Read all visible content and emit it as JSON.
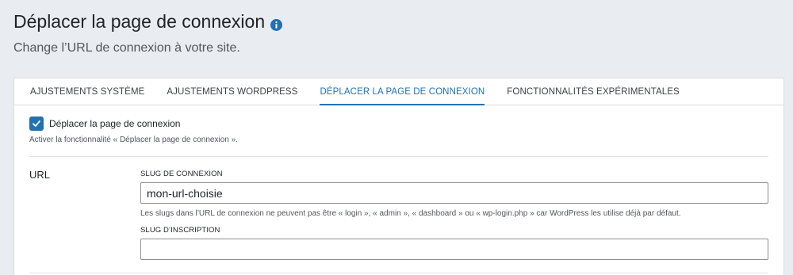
{
  "header": {
    "title": "Déplacer la page de connexion",
    "subtitle": "Change l’URL de connexion à votre site.",
    "info_icon": "info-circle-icon"
  },
  "tabs": [
    {
      "label": "AJUSTEMENTS SYSTÈME",
      "active": false
    },
    {
      "label": "AJUSTEMENTS WORDPRESS",
      "active": false
    },
    {
      "label": "DÉPLACER LA PAGE DE CONNEXION",
      "active": true
    },
    {
      "label": "FONCTIONNALITÉS EXPÉRIMENTALES",
      "active": false
    }
  ],
  "feature": {
    "checkbox_label": "Déplacer la page de connexion",
    "checked": true,
    "description": "Activer la fonctionnalité « Déplacer la page de connexion »."
  },
  "url_section": {
    "label": "URL",
    "login_slug_label": "SLUG DE CONNEXION",
    "login_slug_value": "mon-url-choisie",
    "login_slug_help": "Les slugs dans l’URL de connexion ne peuvent pas être « login », « admin », « dashboard » ou « wp-login.php » car WordPress les utilise déjà par défaut.",
    "register_slug_label": "SLUG D’INSCRIPTION",
    "register_slug_value": ""
  },
  "colors": {
    "accent": "#2271b1",
    "background": "#e9ecf0"
  }
}
